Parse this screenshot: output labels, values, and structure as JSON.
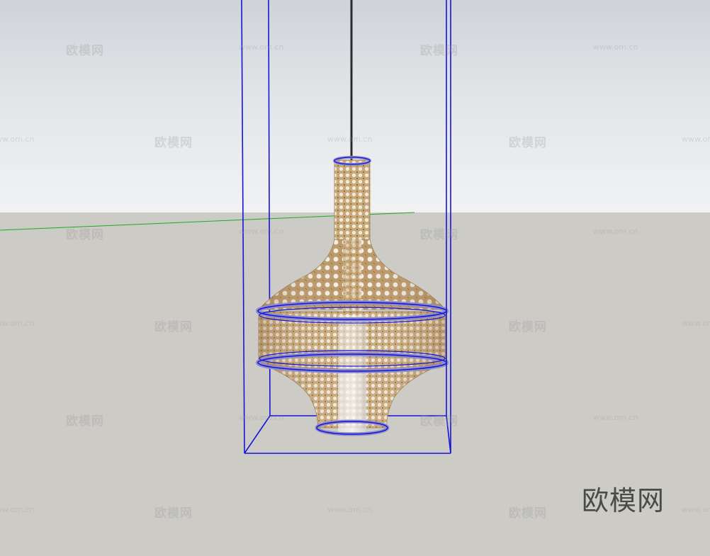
{
  "scene": {
    "kind": "3d-modeling-viewport",
    "object_name": "woven-rattan-pendant-lamp",
    "selection_color": "#1414dc",
    "axis_color": "#22aa22",
    "rattan_color": "#c8a878",
    "cord_color": "#333333"
  },
  "watermark": {
    "brand": "欧模网",
    "brand_url": "www.om.cn",
    "overlay_text": "欧模网"
  }
}
